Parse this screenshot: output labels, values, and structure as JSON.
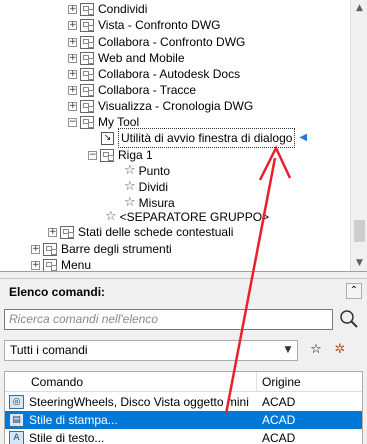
{
  "tree": {
    "items": [
      {
        "label": "Condividi"
      },
      {
        "label": "Vista - Confronto DWG"
      },
      {
        "label": "Collabora - Confronto DWG"
      },
      {
        "label": "Web and Mobile"
      },
      {
        "label": "Collabora - Autodesk Docs"
      },
      {
        "label": "Collabora - Tracce"
      },
      {
        "label": "Visualizza - Cronologia DWG"
      },
      {
        "label": "My Tool"
      },
      {
        "label": "Utilità di avvio finestra di dialogo"
      },
      {
        "label": "Riga 1"
      },
      {
        "label": "Punto"
      },
      {
        "label": "Dividi"
      },
      {
        "label": "Misura"
      },
      {
        "label": "<SEPARATORE GRUPPO>"
      },
      {
        "label": "Stati delle schede contestuali"
      },
      {
        "label": "Barre degli strumenti"
      },
      {
        "label": "Menu"
      }
    ]
  },
  "command_panel": {
    "title": "Elenco comandi:",
    "search_placeholder": "Ricerca comandi nell'elenco",
    "filter_value": "Tutti i comandi",
    "columns": {
      "command": "Comando",
      "origin": "Origine"
    },
    "rows": [
      {
        "command": "SteeringWheels, Disco Vista oggetto mini",
        "origin": "ACAD"
      },
      {
        "command": "Stile di stampa...",
        "origin": "ACAD"
      },
      {
        "command": "Stile di testo...",
        "origin": "ACAD"
      }
    ]
  },
  "colors": {
    "selection": "#0078d7",
    "annotation_arrow": "#e8202a",
    "indicator": "#1e7ad6"
  }
}
